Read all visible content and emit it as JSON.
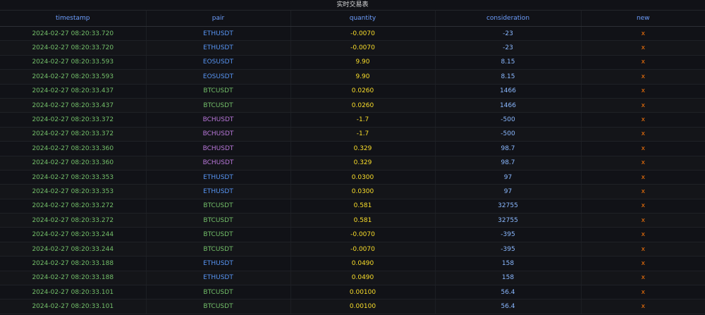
{
  "panel": {
    "title": "实时交易表"
  },
  "columns": [
    "timestamp",
    "pair",
    "quantity",
    "consideration",
    "new"
  ],
  "colors": {
    "header": "#6e9fff",
    "timestamp": "#73bf69",
    "quantity": "#fade2a",
    "consideration": "#8ab8ff",
    "new": "#ff780a",
    "pairs": {
      "ETHUSDT": "#5794f2",
      "EOSUSDT": "#5794f2",
      "BTCUSDT": "#73bf69",
      "BCHUSDT": "#b877d9"
    }
  },
  "rows": [
    {
      "timestamp": "2024-02-27 08:20:33.720",
      "pair": "ETHUSDT",
      "quantity": "-0.0070",
      "consideration": "-23",
      "new": "x"
    },
    {
      "timestamp": "2024-02-27 08:20:33.720",
      "pair": "ETHUSDT",
      "quantity": "-0.0070",
      "consideration": "-23",
      "new": "x"
    },
    {
      "timestamp": "2024-02-27 08:20:33.593",
      "pair": "EOSUSDT",
      "quantity": "9.90",
      "consideration": "8.15",
      "new": "x"
    },
    {
      "timestamp": "2024-02-27 08:20:33.593",
      "pair": "EOSUSDT",
      "quantity": "9.90",
      "consideration": "8.15",
      "new": "x"
    },
    {
      "timestamp": "2024-02-27 08:20:33.437",
      "pair": "BTCUSDT",
      "quantity": "0.0260",
      "consideration": "1466",
      "new": "x"
    },
    {
      "timestamp": "2024-02-27 08:20:33.437",
      "pair": "BTCUSDT",
      "quantity": "0.0260",
      "consideration": "1466",
      "new": "x"
    },
    {
      "timestamp": "2024-02-27 08:20:33.372",
      "pair": "BCHUSDT",
      "quantity": "-1.7",
      "consideration": "-500",
      "new": "x"
    },
    {
      "timestamp": "2024-02-27 08:20:33.372",
      "pair": "BCHUSDT",
      "quantity": "-1.7",
      "consideration": "-500",
      "new": "x"
    },
    {
      "timestamp": "2024-02-27 08:20:33.360",
      "pair": "BCHUSDT",
      "quantity": "0.329",
      "consideration": "98.7",
      "new": "x"
    },
    {
      "timestamp": "2024-02-27 08:20:33.360",
      "pair": "BCHUSDT",
      "quantity": "0.329",
      "consideration": "98.7",
      "new": "x"
    },
    {
      "timestamp": "2024-02-27 08:20:33.353",
      "pair": "ETHUSDT",
      "quantity": "0.0300",
      "consideration": "97",
      "new": "x"
    },
    {
      "timestamp": "2024-02-27 08:20:33.353",
      "pair": "ETHUSDT",
      "quantity": "0.0300",
      "consideration": "97",
      "new": "x"
    },
    {
      "timestamp": "2024-02-27 08:20:33.272",
      "pair": "BTCUSDT",
      "quantity": "0.581",
      "consideration": "32755",
      "new": "x"
    },
    {
      "timestamp": "2024-02-27 08:20:33.272",
      "pair": "BTCUSDT",
      "quantity": "0.581",
      "consideration": "32755",
      "new": "x"
    },
    {
      "timestamp": "2024-02-27 08:20:33.244",
      "pair": "BTCUSDT",
      "quantity": "-0.0070",
      "consideration": "-395",
      "new": "x"
    },
    {
      "timestamp": "2024-02-27 08:20:33.244",
      "pair": "BTCUSDT",
      "quantity": "-0.0070",
      "consideration": "-395",
      "new": "x"
    },
    {
      "timestamp": "2024-02-27 08:20:33.188",
      "pair": "ETHUSDT",
      "quantity": "0.0490",
      "consideration": "158",
      "new": "x"
    },
    {
      "timestamp": "2024-02-27 08:20:33.188",
      "pair": "ETHUSDT",
      "quantity": "0.0490",
      "consideration": "158",
      "new": "x"
    },
    {
      "timestamp": "2024-02-27 08:20:33.101",
      "pair": "BTCUSDT",
      "quantity": "0.00100",
      "consideration": "56.4",
      "new": "x"
    },
    {
      "timestamp": "2024-02-27 08:20:33.101",
      "pair": "BTCUSDT",
      "quantity": "0.00100",
      "consideration": "56.4",
      "new": "x"
    }
  ]
}
